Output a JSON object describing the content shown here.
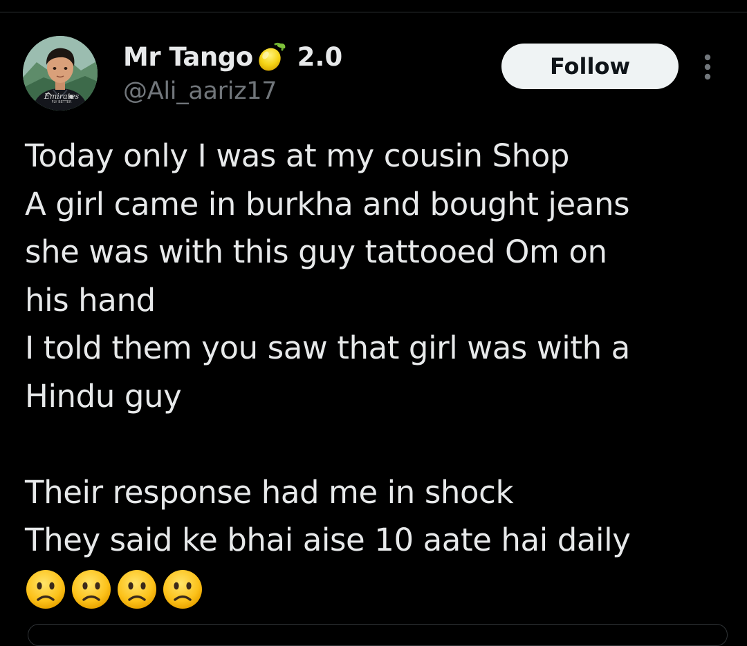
{
  "author": {
    "display_name": "Mr Tango",
    "name_emoji": "lemon-icon",
    "name_suffix": "2.0",
    "handle": "@Ali_aariz17",
    "avatar_text": [
      "Emirates",
      "FLY BETTER"
    ]
  },
  "actions": {
    "follow_label": "Follow",
    "more_icon": "more-vertical-icon"
  },
  "tweet": {
    "lines": [
      "Today only I was at my cousin Shop",
      "A girl came in burkha and bought jeans",
      "she was with this guy tattooed Om on",
      "his hand",
      "I told them you saw that girl was with a",
      "Hindu guy",
      "",
      "Their response had me in shock",
      "They said ke bhai aise 10 aate hai daily"
    ],
    "emojis": [
      "slightly-frowning-face-icon",
      "slightly-frowning-face-icon",
      "slightly-frowning-face-icon",
      "slightly-frowning-face-icon"
    ]
  },
  "colors": {
    "background": "#000000",
    "text_primary": "#e7e9ea",
    "text_secondary": "#71767b",
    "button_bg": "#eff3f4",
    "button_text": "#0f1419",
    "divider": "#2f3336"
  }
}
